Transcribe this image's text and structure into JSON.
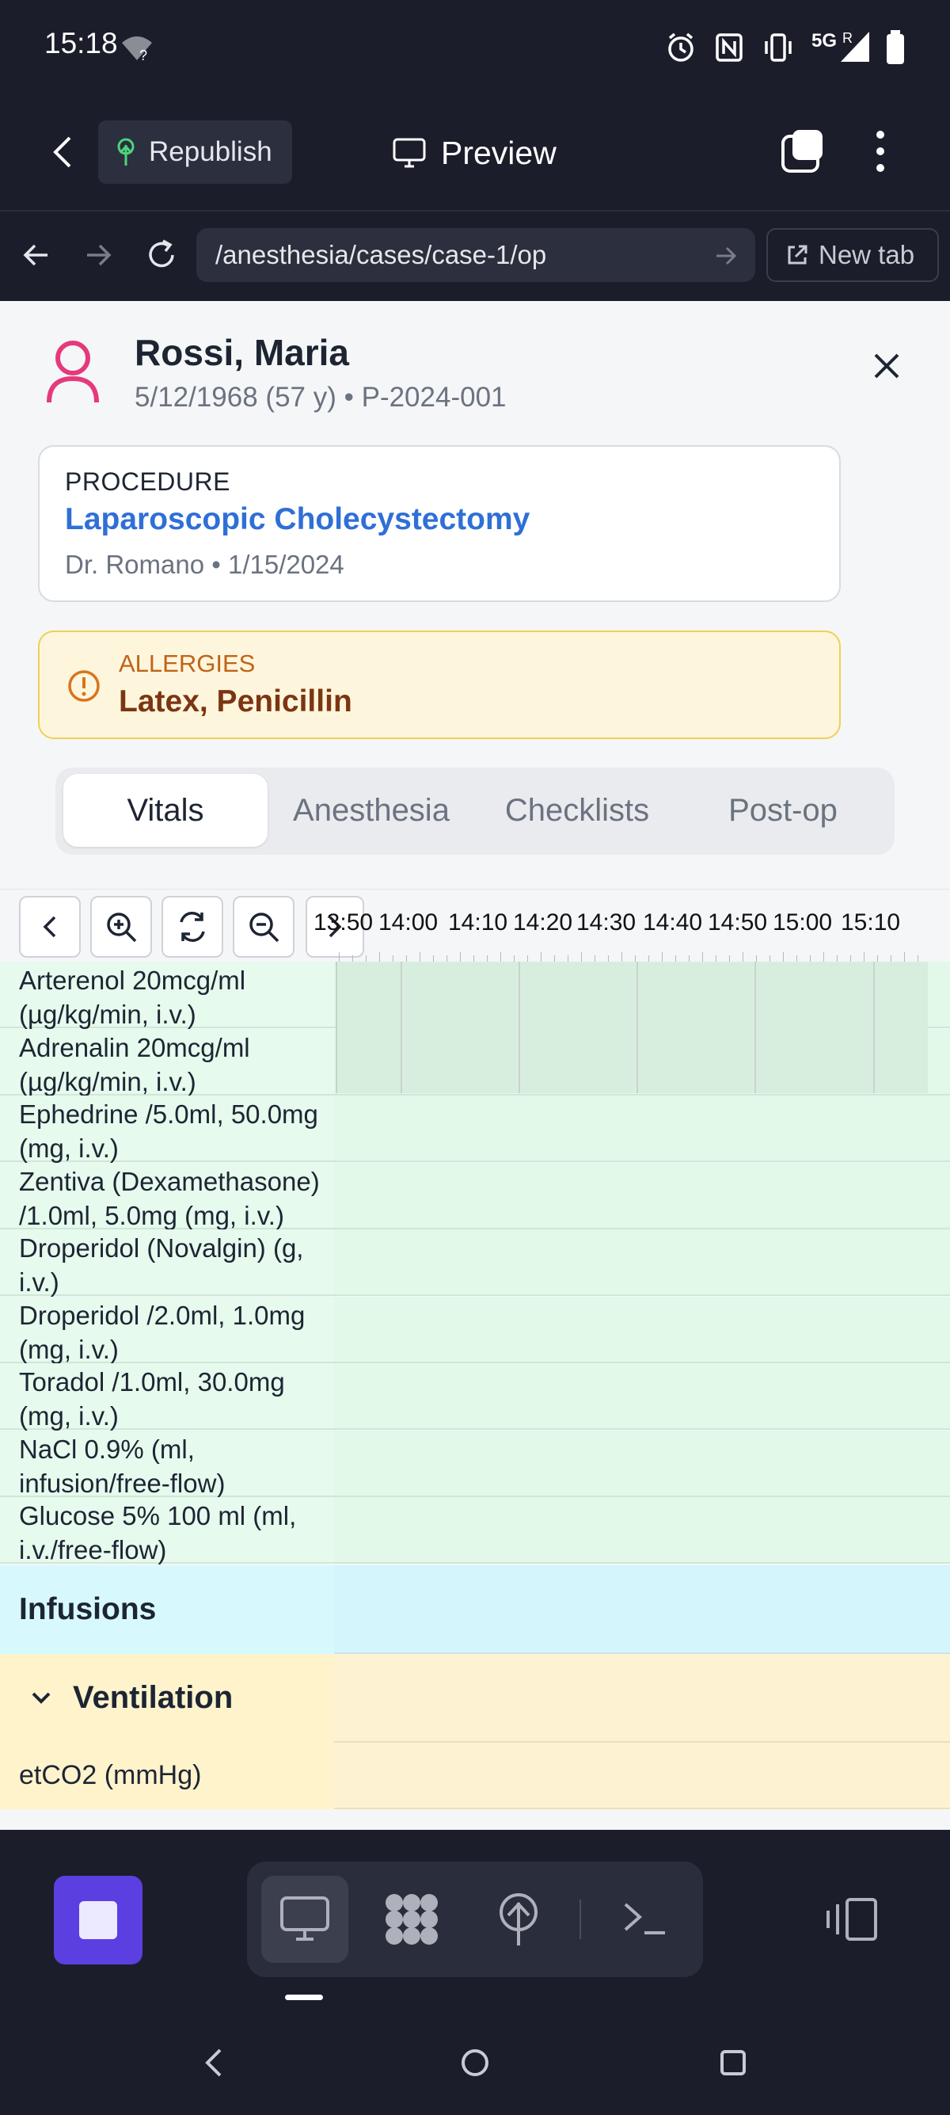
{
  "status_bar": {
    "time": "15:18",
    "network": "5G"
  },
  "header": {
    "republish_label": "Republish",
    "preview_label": "Preview"
  },
  "browser": {
    "url": "/anesthesia/cases/case-1/op",
    "new_tab_label": "New tab"
  },
  "patient": {
    "name": "Rossi, Maria",
    "meta": "5/12/1968 (57 y) • P-2024-001"
  },
  "procedure": {
    "label": "PROCEDURE",
    "title": "Laparoscopic Cholecystectomy",
    "meta": "Dr. Romano • 1/15/2024"
  },
  "allergies": {
    "label": "ALLERGIES",
    "value": "Latex, Penicillin"
  },
  "tabs": [
    {
      "label": "Vitals",
      "active": true
    },
    {
      "label": "Anesthesia",
      "active": false
    },
    {
      "label": "Checklists",
      "active": false
    },
    {
      "label": "Post-op",
      "active": false
    }
  ],
  "timeline": {
    "ticks": [
      "13:50",
      "14:00",
      "14:10",
      "14:20",
      "14:30",
      "14:40",
      "14:50",
      "15:00",
      "15:10"
    ]
  },
  "medications": [
    "Arterenol 20mcg/ml (µg/kg/min, i.v.)",
    "Adrenalin 20mcg/ml (µg/kg/min, i.v.)",
    "Ephedrine /5.0ml, 50.0mg (mg, i.v.)",
    "Zentiva (Dexamethasone) /1.0ml, 5.0mg (mg, i.v.)",
    "Droperidol (Novalgin) (g, i.v.)",
    "Droperidol /2.0ml, 1.0mg (mg, i.v.)",
    "Toradol /1.0ml, 30.0mg (mg, i.v.)",
    "NaCl 0.9% (ml, infusion/free-flow)",
    "Glucose 5% 100 ml (ml, i.v./free-flow)"
  ],
  "sections": {
    "infusions": "Infusions",
    "ventilation": "Ventilation",
    "etco2": "etCO2 (mmHg)"
  },
  "colors": {
    "accent": "#2f6fd6",
    "allergy": "#c0641a",
    "med_row": "#e2f9ea",
    "infusion_row": "#d3f5fb",
    "ventilation_row": "#fdf3d2",
    "stop_button": "#5b3fe0"
  }
}
